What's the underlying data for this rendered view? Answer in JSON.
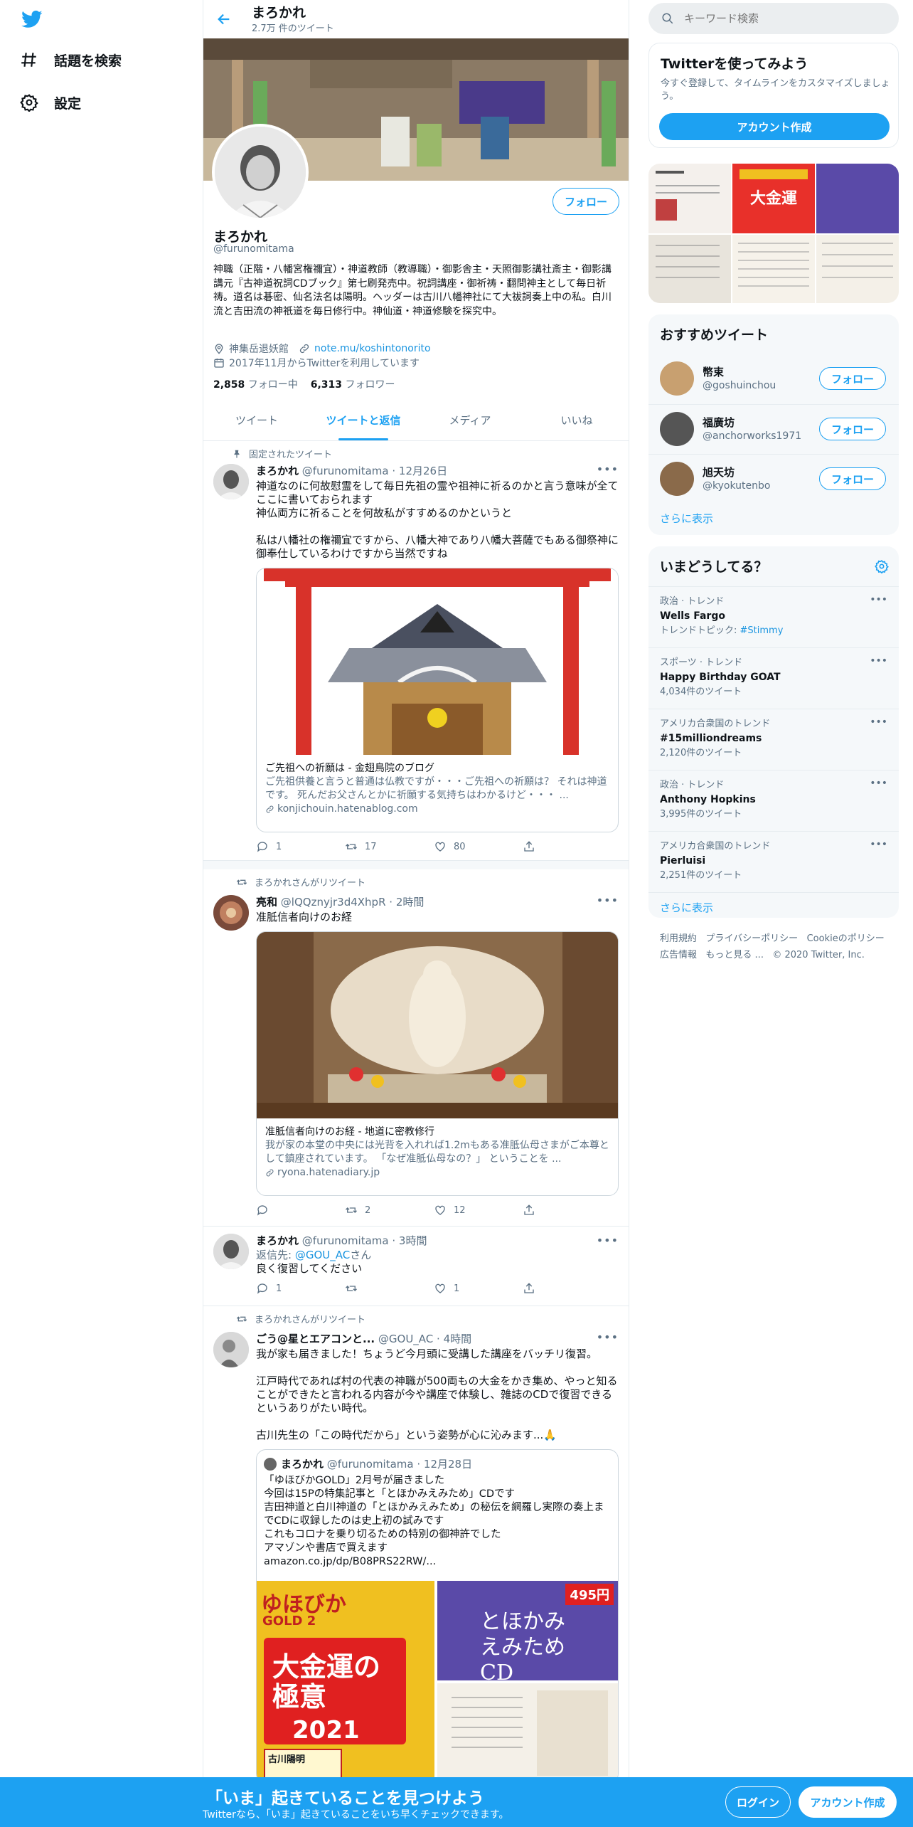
{
  "nav": {
    "explore_label": "話題を検索",
    "settings_label": "設定"
  },
  "header": {
    "name": "まろかれ",
    "tweet_count": "2.7万 件のツイート"
  },
  "profile": {
    "name": "まろかれ",
    "handle": "@furunomitama",
    "follow_label": "フォロー",
    "bio": "神職（正階・八幡宮権禰宜）・神道教師（教導職）・御影舎主・天照御影講社斎主・御影講講元『古神道祝詞CDブック』第七刷発売中。祝詞講座・御祈祷・翻問神主として毎日祈祷。道名は碁密、仙名法名は陽明。ヘッダーは古川八幡神社にて大祓詞奏上中の私。白川流と吉田流の神祇道を毎日修行中。神仙道・神道修験を探究中。",
    "location": "神集岳退妖館",
    "url": "note.mu/koshintonorito",
    "joined": "2017年11月からTwitterを利用しています",
    "following_count": "2,858",
    "following_label": "フォロー中",
    "followers_count": "6,313",
    "followers_label": "フォロワー"
  },
  "tabs": [
    {
      "label": "ツイート"
    },
    {
      "label": "ツイートと返信"
    },
    {
      "label": "メディア"
    },
    {
      "label": "いいね"
    }
  ],
  "tweets": [
    {
      "context": "固定されたツイート",
      "name": "まろかれ",
      "handle": "@furunomitama",
      "time": "12月26日",
      "text": "神道なのに何故慰霊をして毎日先祖の霊や祖神に祈るのかと言う意味が全てここに書いておられます\n神仏両方に祈ることを何故私がすすめるのかというと\n\n私は八幡社の権禰宜ですから、八幡大神であり八幡大菩薩でもある御祭神に御奉仕しているわけですから当然ですね",
      "card_title": "ご先祖への祈願は - 金翅鳥院のブログ",
      "card_desc": "ご先祖供養と言うと普通は仏教ですが・・・ご先祖への祈願は？ それは神道です。 死んだお父さんとかに祈願する気持ちはわかるけど・・・ ...",
      "card_domain": "konjichouin.hatenablog.com",
      "replies": "1",
      "retweets": "17",
      "likes": "80"
    },
    {
      "context": "まろかれさんがリツイート",
      "name": "亮和",
      "handle": "@lQQznyjr3d4XhpR",
      "time": "2時間",
      "text": "准胝信者向けのお経",
      "card_title": "准胝信者向けのお経 - 地道に密教修行",
      "card_desc": "我が家の本堂の中央には光背を入れれば1.2mもある准胝仏母さまがご本尊として鎮座されています。 「なぜ准胝仏母なの？」 ということを ...",
      "card_domain": "ryona.hatenadiary.jp",
      "replies": "",
      "retweets": "2",
      "likes": "12"
    },
    {
      "name": "まろかれ",
      "handle": "@furunomitama",
      "time": "3時間",
      "reply_prefix": "返信先: ",
      "reply_to": "@GOU_AC",
      "reply_suffix": "さん",
      "text": "良く復習してください",
      "replies": "1",
      "retweets": "",
      "likes": "1"
    },
    {
      "context": "まろかれさんがリツイート",
      "name": "ごう@星とエアコンと...",
      "handle": "@GOU_AC",
      "time": "4時間",
      "text": "我が家も届きました！ちょうど今月頭に受講した講座をバッチリ復習。\n\n江戸時代であれば村の代表の神職が500両もの大金をかき集め、やっと知ることができたと言われる内容が今や講座で体験し、雑誌のCDで復習できるというありがたい時代。\n\n古川先生の「この時代だから」という姿勢が心に沁みます...🙏",
      "quote": {
        "name": "まろかれ",
        "handle": "@furunomitama",
        "time": "12月28日",
        "text": "「ゆほびかGOLD」2月号が届きました\n今回は15Pの特集記事と「とほかみえみため」CDです\n吉田神道と白川神道の「とほかみえみため」の秘伝を網羅し実際の奏上までCDに収録したのは史上初の試みです\nこれもコロナを乗り切るための特別の御神許でした\nアマゾンや書店で買えます\namazon.co.jp/dp/B08PRS22RW/..."
      },
      "magazine": {
        "brand": "ゆほびか",
        "gold": "GOLD 2",
        "headline": "大金運の極意",
        "year": "2021",
        "price": "495円",
        "cd_title": "とほかみ えみため CD",
        "author": "古川陽明"
      }
    }
  ],
  "search": {
    "placeholder": "キーワード検索"
  },
  "signup": {
    "title": "Twitterを使ってみよう",
    "desc": "今すぐ登録して、タイムラインをカスタマイズしましょう。",
    "button": "アカウント作成"
  },
  "recommended": {
    "title": "おすすめツイート",
    "users": [
      {
        "name": "幣束",
        "handle": "@goshuinchou",
        "follow": "フォロー"
      },
      {
        "name": "福廣坊",
        "handle": "@anchorworks1971",
        "follow": "フォロー"
      },
      {
        "name": "旭天坊",
        "handle": "@kyokutenbo",
        "follow": "フォロー"
      }
    ],
    "more": "さらに表示"
  },
  "trends": {
    "title": "いまどうしてる？",
    "items": [
      {
        "category": "政治 · トレンド",
        "name": "Wells Fargo",
        "extra_label": "トレンドトピック: ",
        "extra_link": "#Stimmy"
      },
      {
        "category": "スポーツ · トレンド",
        "name": "Happy Birthday GOAT",
        "count": "4,034件のツイート"
      },
      {
        "category": "アメリカ合衆国のトレンド",
        "name": "#15milliondreams",
        "count": "2,120件のツイート"
      },
      {
        "category": "政治 · トレンド",
        "name": "Anthony Hopkins",
        "count": "3,995件のツイート"
      },
      {
        "category": "アメリカ合衆国のトレンド",
        "name": "Pierluisi",
        "count": "2,251件のツイート"
      }
    ],
    "more": "さらに表示"
  },
  "footer": {
    "line1": [
      "利用規約",
      "プライバシーポリシー",
      "Cookieのポリシー"
    ],
    "line2": [
      "広告情報",
      "もっと見る ...",
      "© 2020 Twitter, Inc."
    ]
  },
  "bottom_bar": {
    "title": "「いま」起きていることを見つけよう",
    "subtitle": "Twitterなら、「いま」起きていることをいち早くチェックできます。",
    "login": "ログイン",
    "signup": "アカウント作成"
  },
  "colors": {
    "brand": "#1da1f2",
    "link": "#1b95e0",
    "muted": "#5b7083"
  }
}
